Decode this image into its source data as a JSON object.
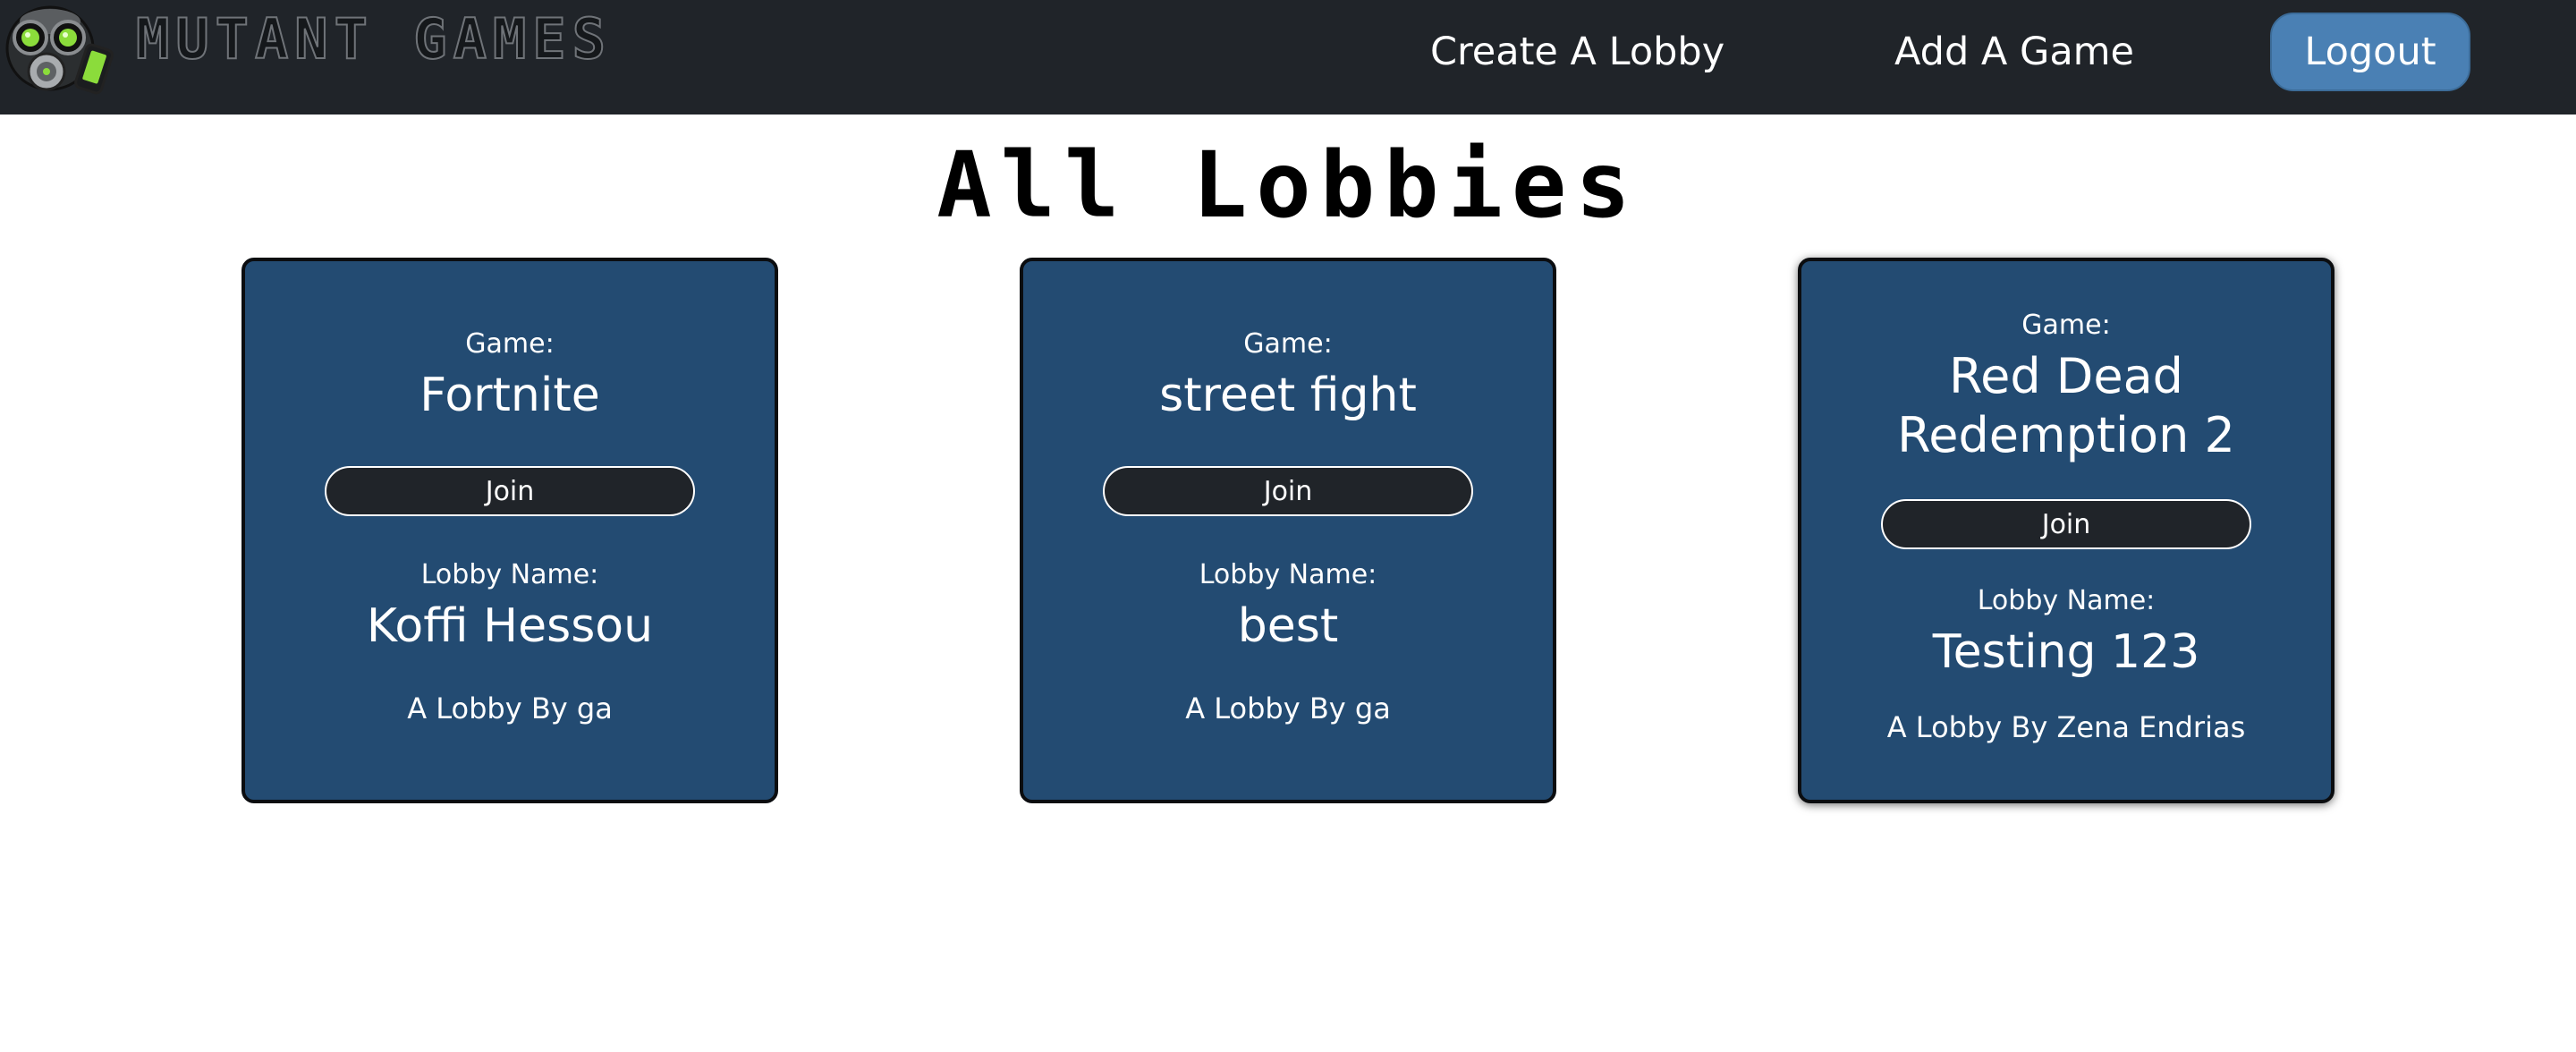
{
  "header": {
    "brand": "MUTANT GAMES",
    "logo_icon": "gas-mask-gamepad-logo",
    "nav": [
      {
        "label": "Create A Lobby"
      },
      {
        "label": "Add A Game"
      }
    ],
    "logout_label": "Logout"
  },
  "page": {
    "title": "All Lobbies"
  },
  "lobbies": [
    {
      "game_label": "Game:",
      "game": "Fortnite",
      "join_label": "Join",
      "lobby_label": "Lobby Name:",
      "lobby_name": "Koffi Hessou",
      "owner_text": "A Lobby By ga"
    },
    {
      "game_label": "Game:",
      "game": "street fight",
      "join_label": "Join",
      "lobby_label": "Lobby Name:",
      "lobby_name": "best",
      "owner_text": "A Lobby By ga"
    },
    {
      "game_label": "Game:",
      "game": "Red Dead Redemption 2",
      "join_label": "Join",
      "lobby_label": "Lobby Name:",
      "lobby_name": "Testing 123",
      "owner_text": "A Lobby By Zena Endrias"
    }
  ],
  "colors": {
    "navbar": "#202429",
    "card": "#234b72",
    "logout_button": "#4a80b4",
    "join_button": "#202429"
  }
}
